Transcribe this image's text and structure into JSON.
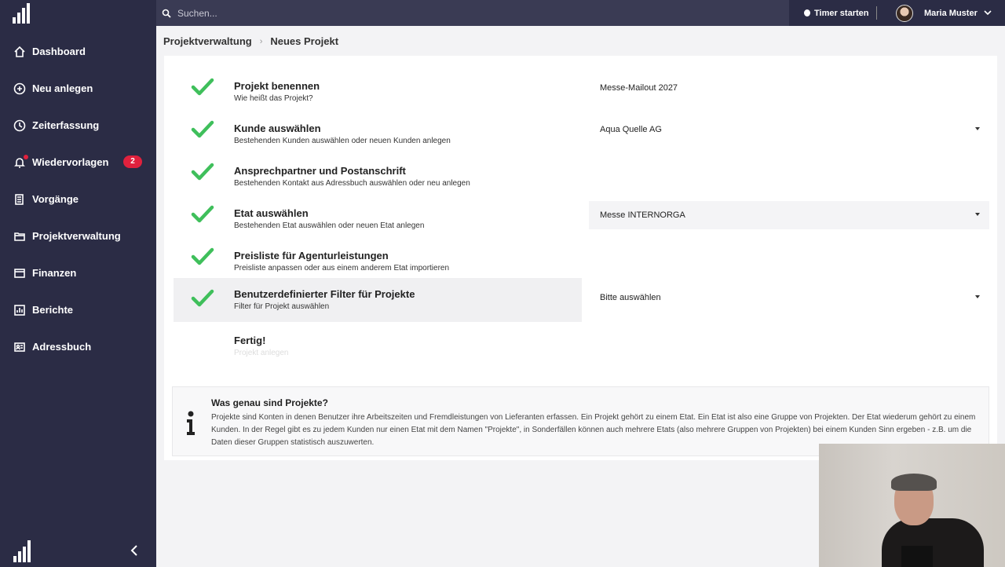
{
  "search": {
    "placeholder": "Suchen..."
  },
  "header": {
    "timer_label": "Timer starten",
    "user_name": "Maria Muster"
  },
  "sidebar": {
    "items": [
      {
        "label": "Dashboard",
        "icon": "home-icon"
      },
      {
        "label": "Neu anlegen",
        "icon": "plus-circle-icon"
      },
      {
        "label": "Zeiterfassung",
        "icon": "clock-icon"
      },
      {
        "label": "Wiedervorlagen",
        "icon": "bell-icon",
        "badge": "2"
      },
      {
        "label": "Vorgänge",
        "icon": "documents-icon"
      },
      {
        "label": "Projektverwaltung",
        "icon": "folder-icon"
      },
      {
        "label": "Finanzen",
        "icon": "wallet-icon"
      },
      {
        "label": "Berichte",
        "icon": "chart-icon"
      },
      {
        "label": "Adressbuch",
        "icon": "address-card-icon"
      }
    ]
  },
  "breadcrumb": {
    "parent": "Projektverwaltung",
    "current": "Neues Projekt"
  },
  "steps": [
    {
      "title": "Projekt benennen",
      "subtitle": "Wie heißt das Projekt?",
      "done": true
    },
    {
      "title": "Kunde auswählen",
      "subtitle": "Bestehenden Kunden auswählen oder neuen Kunden anlegen",
      "done": true
    },
    {
      "title": "Ansprechpartner und Postanschrift",
      "subtitle": "Bestehenden Kontakt aus Adressbuch auswählen oder neu anlegen",
      "done": true
    },
    {
      "title": "Etat auswählen",
      "subtitle": "Bestehenden Etat auswählen oder neuen Etat anlegen",
      "done": true
    },
    {
      "title": "Preisliste für Agenturleistungen",
      "subtitle": "Preisliste anpassen oder aus einem anderem Etat importieren",
      "done": true
    },
    {
      "title": "Benutzerdefinierter Filter für Projekte",
      "subtitle": "Filter für Projekt auswählen",
      "done": true
    },
    {
      "title": "Fertig!",
      "subtitle": "Projekt anlegen",
      "done": false
    }
  ],
  "fields": {
    "project_name": "Messe-Mailout 2027",
    "customer": "Aqua Quelle AG",
    "budget": "Messe INTERNORGA",
    "filter": "Bitte auswählen"
  },
  "info": {
    "title": "Was genau sind Projekte?",
    "text": "Projekte sind Konten in denen Benutzer ihre Arbeitszeiten und Fremdleistungen von Lieferanten erfassen. Ein Projekt gehört zu einem Etat. Ein Etat ist also eine Gruppe von Projekten. Der Etat wiederum gehört zu einem Kunden. In der Regel gibt es zu jedem Kunden nur einen Etat mit dem Namen \"Projekte\", in Sonderfällen können auch mehrere Etats (also mehrere Gruppen von Projekten) bei einem Kunden Sinn ergeben - z.B. um die Daten dieser Gruppen statistisch auszuwerten."
  },
  "colors": {
    "sidebar": "#2b2c45",
    "check": "#3fbf5b",
    "badge": "#e0213d"
  }
}
